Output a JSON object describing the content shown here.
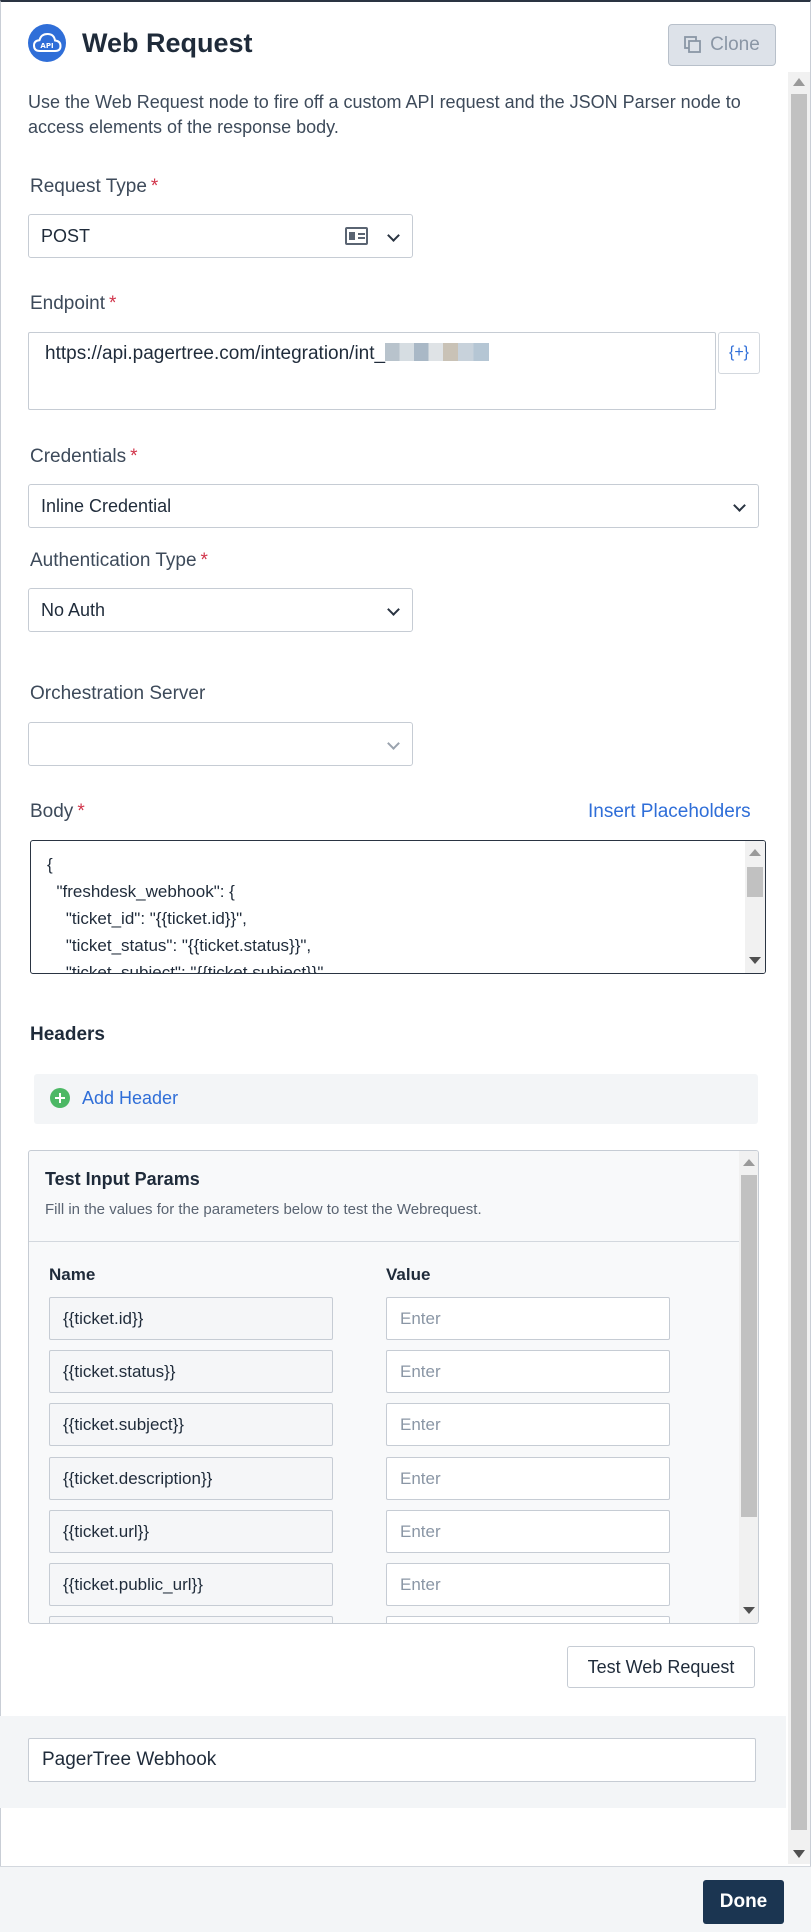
{
  "header": {
    "title": "Web Request",
    "clone_label": "Clone",
    "logo_text": "API"
  },
  "description": "Use the Web Request node to fire off a custom API request and the JSON Parser node to access elements of the response body.",
  "request_type": {
    "label": "Request Type",
    "required_mark": "*",
    "value": "POST"
  },
  "endpoint": {
    "label": "Endpoint",
    "required_mark": "*",
    "value": "https://api.pagertree.com/integration/int_",
    "placeholder_button": "{+}"
  },
  "credentials": {
    "label": "Credentials",
    "required_mark": "*",
    "value": "Inline Credential"
  },
  "auth_type": {
    "label": "Authentication Type",
    "required_mark": "*",
    "value": "No Auth"
  },
  "orchestration": {
    "label": "Orchestration Server",
    "value": ""
  },
  "body": {
    "label": "Body",
    "required_mark": "*",
    "insert_placeholders": "Insert Placeholders",
    "lines": [
      "{",
      "  \"freshdesk_webhook\": {",
      "    \"ticket_id\": \"{{ticket.id}}\",",
      "    \"ticket_status\": \"{{ticket.status}}\",",
      "    \"ticket_subject\": \"{{ticket.subject}}\","
    ]
  },
  "headers": {
    "title": "Headers",
    "add_label": "Add Header"
  },
  "test_params": {
    "title": "Test Input Params",
    "description": "Fill in the values for the parameters below to test the Webrequest.",
    "col_name": "Name",
    "col_value": "Value",
    "rows": [
      {
        "name": "{{ticket.id}}",
        "value_placeholder": "Enter"
      },
      {
        "name": "{{ticket.status}}",
        "value_placeholder": "Enter"
      },
      {
        "name": "{{ticket.subject}}",
        "value_placeholder": "Enter"
      },
      {
        "name": "{{ticket.description}}",
        "value_placeholder": "Enter"
      },
      {
        "name": "{{ticket.url}}",
        "value_placeholder": "Enter"
      },
      {
        "name": "{{ticket.public_url}}",
        "value_placeholder": "Enter"
      }
    ]
  },
  "test_button": "Test Web Request",
  "node_name": "PagerTree Webhook",
  "done_label": "Done",
  "colors": {
    "primary": "#1b3551",
    "link": "#2f6ed8",
    "required": "#d1344a",
    "success": "#4cb865"
  }
}
